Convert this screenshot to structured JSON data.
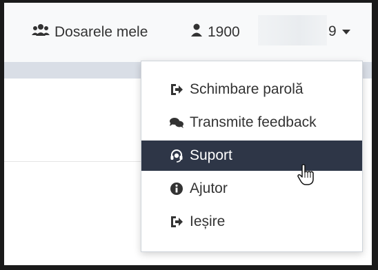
{
  "nav": {
    "dosare_label": "Dosarele mele",
    "user_label": "1900",
    "menu_number": "9"
  },
  "menu": {
    "items": [
      {
        "label": "Schimbare parolă",
        "icon": "sign-out-icon"
      },
      {
        "label": "Transmite feedback",
        "icon": "comments-icon"
      },
      {
        "label": "Suport",
        "icon": "headset-icon",
        "active": true
      },
      {
        "label": "Ajutor",
        "icon": "info-icon"
      },
      {
        "label": "Ieșire",
        "icon": "sign-out-icon"
      }
    ]
  },
  "colors": {
    "active_bg": "#2e3647",
    "text": "#333333",
    "band": "#d9dee6"
  }
}
